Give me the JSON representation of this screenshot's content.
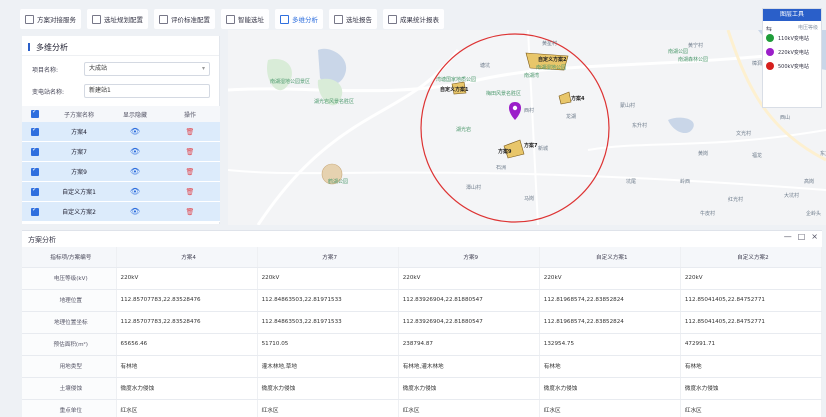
{
  "toolbar": {
    "items": [
      {
        "label": "方案对接服务",
        "active": false
      },
      {
        "label": "选址规划配置",
        "active": false
      },
      {
        "label": "评价标准配置",
        "active": false
      },
      {
        "label": "智能选址",
        "active": false
      },
      {
        "label": "多维分析",
        "active": true
      },
      {
        "label": "选址报告",
        "active": false
      },
      {
        "label": "成果统计报表",
        "active": false
      }
    ]
  },
  "legend": {
    "title": "图层工具",
    "subtitle": "电压等级",
    "items": [
      {
        "label": "110kV变电站",
        "color": "#1f9d3a"
      },
      {
        "label": "220kV变电站",
        "color": "#9b1fc9"
      },
      {
        "label": "500kV变电站",
        "color": "#d6201e"
      }
    ]
  },
  "left_panel": {
    "title": "多维分析",
    "project_label": "项目名称:",
    "project_value": "大成站",
    "station_label": "变电站名称:",
    "station_value": "新建站1",
    "grid_headers": [
      "子方案名称",
      "显示隐藏",
      "操作"
    ],
    "rows": [
      {
        "name": "方案4"
      },
      {
        "name": "方案7"
      },
      {
        "name": "方案9"
      },
      {
        "name": "自定义方案1"
      },
      {
        "name": "自定义方案2"
      }
    ]
  },
  "map": {
    "labels": [
      {
        "text": "塘坑",
        "cls": ""
      },
      {
        "text": "黄星村",
        "cls": ""
      },
      {
        "text": "黄宁村",
        "cls": ""
      },
      {
        "text": "西村",
        "cls": ""
      },
      {
        "text": "龙湖",
        "cls": ""
      },
      {
        "text": "新城",
        "cls": ""
      },
      {
        "text": "石洲",
        "cls": ""
      },
      {
        "text": "潭山村",
        "cls": ""
      },
      {
        "text": "蒙山村",
        "cls": ""
      },
      {
        "text": "东升村",
        "cls": ""
      },
      {
        "text": "马岗",
        "cls": ""
      },
      {
        "text": "坑尾",
        "cls": ""
      },
      {
        "text": "文光村",
        "cls": ""
      },
      {
        "text": "福龙",
        "cls": ""
      },
      {
        "text": "企岭头",
        "cls": ""
      },
      {
        "text": "牛皮村",
        "cls": ""
      },
      {
        "text": "岭西",
        "cls": ""
      },
      {
        "text": "大坑村",
        "cls": ""
      },
      {
        "text": "红光村",
        "cls": ""
      },
      {
        "text": "黄岗",
        "cls": ""
      },
      {
        "text": "高岗",
        "cls": ""
      },
      {
        "text": "东方",
        "cls": ""
      },
      {
        "text": "樟洞",
        "cls": ""
      },
      {
        "text": "西山",
        "cls": ""
      },
      {
        "text": "南湖湿地公园",
        "cls": "green"
      },
      {
        "text": "南湖湾",
        "cls": "green"
      },
      {
        "text": "湾塘国家地质公园",
        "cls": "green"
      },
      {
        "text": "鹤湖公园",
        "cls": "green"
      },
      {
        "text": "梅田风景名胜区",
        "cls": "green"
      },
      {
        "text": "湖光岩",
        "cls": "green"
      },
      {
        "text": "南湖公园",
        "cls": "green"
      },
      {
        "text": "南湖森林公园",
        "cls": "green"
      },
      {
        "text": "南湖湾景区",
        "cls": "green"
      },
      {
        "text": "南湖湖景区",
        "cls": "green"
      },
      {
        "text": "南湖湿地公园景区",
        "cls": "green"
      },
      {
        "text": "湖光岩风景名胜区",
        "cls": "green"
      }
    ],
    "scheme_tags": [
      "自定义方案2",
      "自定义方案1",
      "方案4",
      "方案7",
      "方案9"
    ]
  },
  "bottom": {
    "title": "方案分析",
    "win_min": "—",
    "win_max": "□",
    "win_close": "×",
    "headers": [
      "指标项/方案编号",
      "方案4",
      "方案7",
      "方案9",
      "自定义方案1",
      "自定义方案2"
    ],
    "rows": [
      {
        "label": "电压等级(kV)",
        "values": [
          "220kV",
          "220kV",
          "220kV",
          "220kV",
          "220kV"
        ]
      },
      {
        "label": "地理位置",
        "values": [
          "112.85707783,22.83528476",
          "112.84863503,22.81971533",
          "112.83926904,22.81880547",
          "112.81968574,22.83852824",
          "112.85041405,22.84752771"
        ]
      },
      {
        "label": "地理位置坐标",
        "values": [
          "112.85707783,22.83528476",
          "112.84863503,22.81971533",
          "112.83926904,22.81880547",
          "112.81968574,22.83852824",
          "112.85041405,22.84752771"
        ]
      },
      {
        "label": "预估面积(m²)",
        "values": [
          "65656.46",
          "51710.05",
          "238794.87",
          "132954.75",
          "472991.71"
        ]
      },
      {
        "label": "用地类型",
        "values": [
          "有林地",
          "灌木林地,草地",
          "有林地,灌木林地",
          "有林地",
          "有林地"
        ]
      },
      {
        "label": "土壤侵蚀",
        "values": [
          "微度水力侵蚀",
          "微度水力侵蚀",
          "微度水力侵蚀",
          "微度水力侵蚀",
          "微度水力侵蚀"
        ]
      },
      {
        "label": "重点单位",
        "values": [
          "红水区",
          "红水区",
          "红水区",
          "红水区",
          "红水区"
        ]
      }
    ]
  }
}
